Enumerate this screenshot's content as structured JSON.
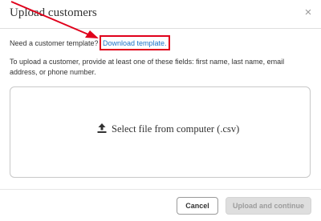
{
  "dialog": {
    "title": "Upload customers",
    "close_symbol": "×"
  },
  "template": {
    "prompt": "Need a customer template?",
    "link": "Download template."
  },
  "instructions": "To upload a customer, provide at least one of these fields: first name, last name, email address, or phone number.",
  "dropzone": {
    "label": "Select file from computer (.csv)",
    "icon": "upload-icon"
  },
  "footer": {
    "cancel_label": "Cancel",
    "upload_label": "Upload and continue"
  },
  "colors": {
    "annotation_red": "#e0001b",
    "link_blue": "#1a73c6",
    "disabled_button_bg": "#dedede"
  }
}
